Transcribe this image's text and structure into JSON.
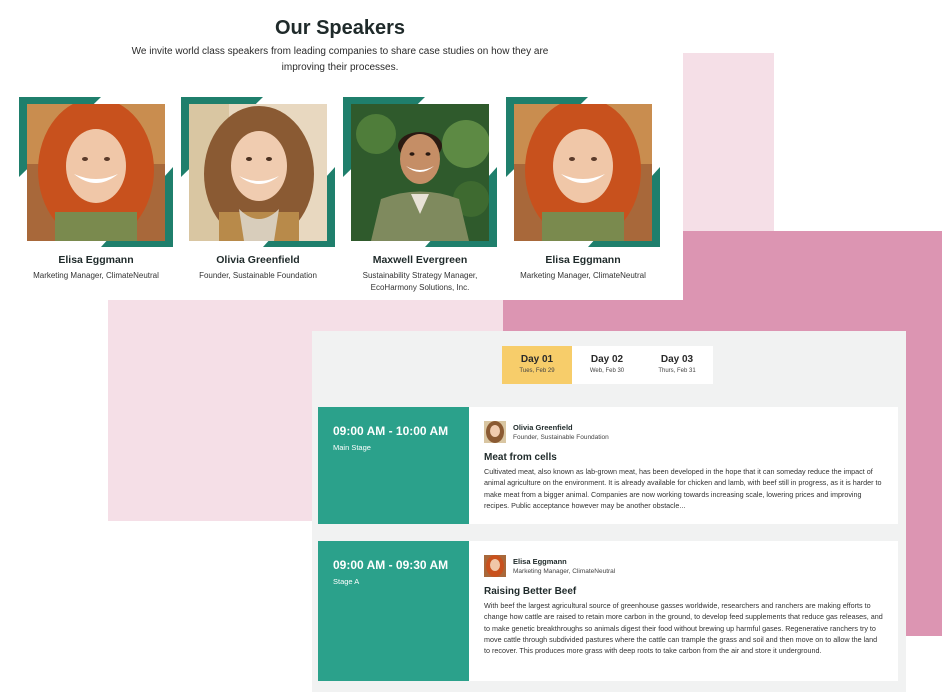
{
  "speakers_section": {
    "title": "Our Speakers",
    "subtitle": "We invite world class speakers from leading companies to share case studies on how they are improving their processes.",
    "speakers": [
      {
        "name": "Elisa Eggmann",
        "role": "Marketing Manager, ClimateNeutral"
      },
      {
        "name": "Olivia Greenfield",
        "role": "Founder, Sustainable Foundation"
      },
      {
        "name": "Maxwell Evergreen",
        "role": "Sustainability Strategy Manager, EcoHarmony Solutions, Inc."
      },
      {
        "name": "Elisa Eggmann",
        "role": "Marketing Manager, ClimateNeutral"
      }
    ]
  },
  "schedule": {
    "tabs": [
      {
        "day": "Day 01",
        "date": "Tues, Feb 29",
        "active": true
      },
      {
        "day": "Day 02",
        "date": "Web, Feb 30",
        "active": false
      },
      {
        "day": "Day 03",
        "date": "Thurs, Feb 31",
        "active": false
      }
    ],
    "sessions": [
      {
        "time": "09:00 AM - 10:00 AM",
        "stage": "Main Stage",
        "speaker_name": "Olivia Greenfield",
        "speaker_role": "Founder, Sustainable Foundation",
        "title": "Meat from cells",
        "description": "Cultivated meat, also known as lab-grown meat, has been developed in the hope that it can someday reduce the impact of animal agriculture on the environment. It is already available for chicken and lamb, with beef still in progress, as it is harder to make meat from a bigger animal. Companies are now working towards increasing scale, lowering prices and improving recipes. Public acceptance however may be another obstacle..."
      },
      {
        "time": "09:00 AM - 09:30 AM",
        "stage": "Stage A",
        "speaker_name": "Elisa Eggmann",
        "speaker_role": "Marketing Manager, ClimateNeutral",
        "title": "Raising Better Beef",
        "description": "With beef the largest agricultural source of greenhouse gasses worldwide, researchers and ranchers are making efforts to change how cattle are raised to retain more carbon in the ground, to develop feed supplements that reduce gas releases, and to make genetic breakthroughs so animals digest their food without brewing up harmful gases. Regenerative ranchers try to move cattle through subdivided pastures where the cattle can trample the grass and soil and then move on to allow the land to recover. This produces more grass with deep roots to take carbon from the air and store it underground."
      }
    ]
  },
  "colors": {
    "teal": "#2ba18b",
    "teal_dark": "#1f7f6c",
    "active_tab": "#f7cd6a",
    "pink_light": "#f5dfe7",
    "pink_dark": "#dc95b2"
  }
}
